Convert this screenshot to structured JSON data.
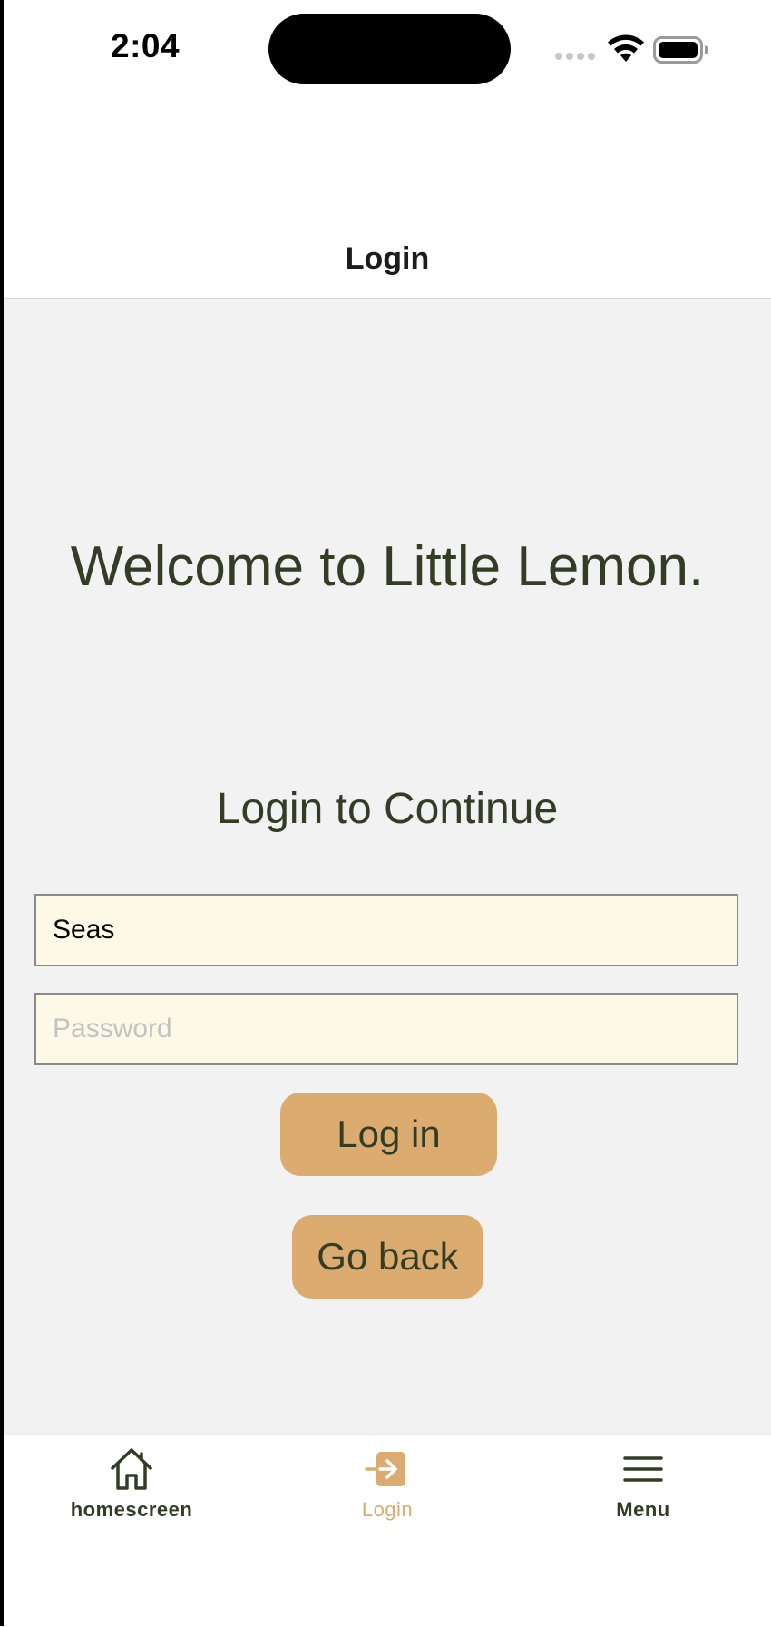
{
  "status_bar": {
    "time": "2:04"
  },
  "header": {
    "title": "Login"
  },
  "main": {
    "welcome": "Welcome to Little Lemon.",
    "subtitle": "Login to Continue",
    "username_value": "Seas",
    "password_placeholder": "Password",
    "login_button": "Log in",
    "back_button": "Go back"
  },
  "tab_bar": {
    "tabs": [
      {
        "label": "homescreen",
        "icon": "house-icon",
        "active": false
      },
      {
        "label": "Login",
        "icon": "login-arrow-icon",
        "active": true
      },
      {
        "label": "Menu",
        "icon": "hamburger-menu-icon",
        "active": false
      }
    ]
  },
  "colors": {
    "primary_green": "#333d25",
    "accent_gold": "#dbab70",
    "input_bg": "#fcf9e6",
    "content_bg": "#f2f2f2"
  }
}
